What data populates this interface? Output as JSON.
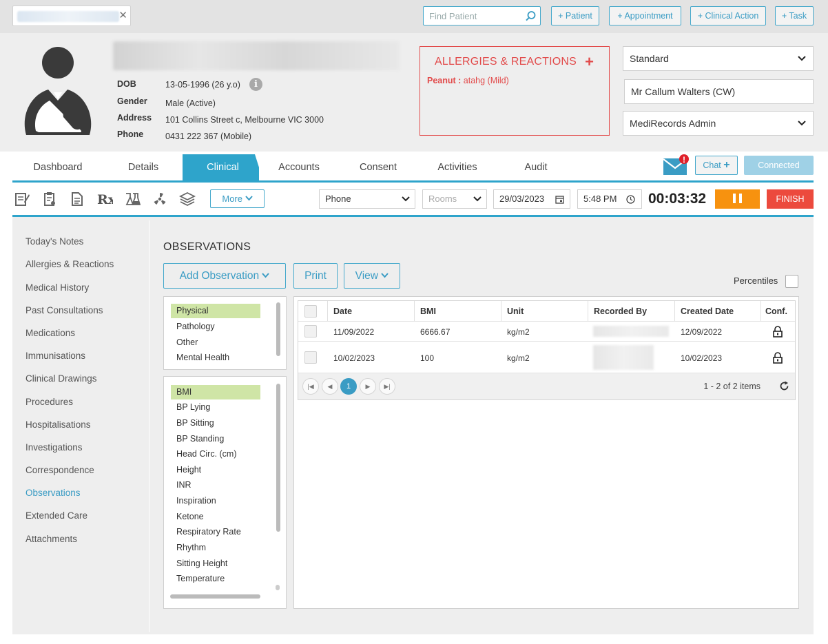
{
  "topbar": {
    "find_placeholder": "Find Patient",
    "buttons": [
      "+ Patient",
      "+ Appointment",
      "+ Clinical Action",
      "+ Task"
    ]
  },
  "patient": {
    "labels": {
      "dob": "DOB",
      "gender": "Gender",
      "address": "Address",
      "phone": "Phone"
    },
    "dob": "13-05-1996 (26 y.o)",
    "gender": "Male (Active)",
    "address": "101 Collins Street c, Melbourne VIC 3000",
    "phone": "0431 222 367 (Mobile)"
  },
  "allergies": {
    "title": "ALLERGIES & REACTIONS",
    "add_symbol": "+",
    "item_name": "Peanut :",
    "item_detail": " atahg (Mild)"
  },
  "header_selects": {
    "template": "Standard",
    "provider": "Mr Callum Walters (CW)",
    "user": "MediRecords Admin"
  },
  "tabs": [
    "Dashboard",
    "Details",
    "Clinical",
    "Accounts",
    "Consent",
    "Activities",
    "Audit"
  ],
  "active_tab": "Clinical",
  "chat_label": "Chat",
  "connected_label": "Connected",
  "notification_mark": "!",
  "toolbar": {
    "more_label": "More",
    "contact_type": "Phone",
    "rooms_placeholder": "Rooms",
    "date": "29/03/2023",
    "time": "5:48 PM",
    "timer": "00:03:32",
    "finish_label": "FINISH"
  },
  "sidebar": {
    "items": [
      "Today's Notes",
      "Allergies & Reactions",
      "Medical History",
      "Past Consultations",
      "Medications",
      "Immunisations",
      "Clinical Drawings",
      "Procedures",
      "Hospitalisations",
      "Investigations",
      "Correspondence",
      "Observations",
      "Extended Care",
      "Attachments"
    ],
    "active": "Observations"
  },
  "observations": {
    "title": "OBSERVATIONS",
    "add_label": "Add Observation",
    "print_label": "Print",
    "view_label": "View",
    "percentiles_label": "Percentiles",
    "categories": [
      "Physical",
      "Pathology",
      "Other",
      "Mental Health"
    ],
    "selected_category": "Physical",
    "types": [
      "BMI",
      "BP Lying",
      "BP Sitting",
      "BP Standing",
      "Head Circ. (cm)",
      "Height",
      "INR",
      "Inspiration",
      "Ketone",
      "Respiratory Rate",
      "Rhythm",
      "Sitting Height",
      "Temperature"
    ],
    "selected_type": "BMI"
  },
  "grid": {
    "headers": [
      "Date",
      "BMI",
      "Unit",
      "Recorded By",
      "Created Date",
      "Conf."
    ],
    "rows": [
      {
        "date": "11/09/2022",
        "bmi": "6666.67",
        "unit": "kg/m2",
        "created": "12/09/2022"
      },
      {
        "date": "10/02/2023",
        "bmi": "100",
        "unit": "kg/m2",
        "created": "10/02/2023"
      }
    ],
    "pager": {
      "current_page": "1",
      "info": "1 - 2 of 2 items"
    }
  }
}
